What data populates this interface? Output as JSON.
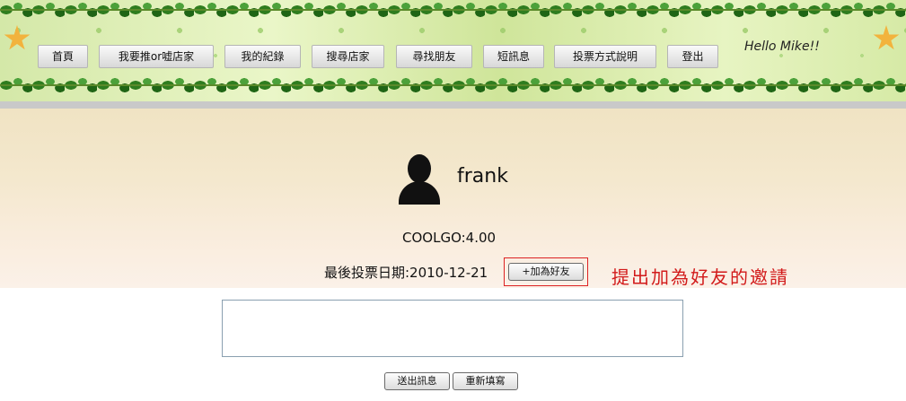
{
  "nav": {
    "items": [
      {
        "label": "首頁"
      },
      {
        "label": "我要推or嘘店家"
      },
      {
        "label": "我的紀錄"
      },
      {
        "label": "搜尋店家"
      },
      {
        "label": "尋找朋友"
      },
      {
        "label": "短訊息"
      },
      {
        "label": "投票方式說明"
      },
      {
        "label": "登出"
      }
    ],
    "greeting": "Hello Mike!!"
  },
  "profile": {
    "username": "frank",
    "score_text": "COOLGO:4.00",
    "last_vote_text": "最後投票日期:2010-12-21",
    "add_friend_label": "+加為好友"
  },
  "annotation": "提出加為好友的邀請",
  "message": {
    "value": "",
    "send_label": "送出訊息",
    "reset_label": "重新填寫"
  },
  "colors": {
    "annotation": "#d21a1a",
    "header_green": "#d4e8a8",
    "band": "#f0e3c3"
  }
}
